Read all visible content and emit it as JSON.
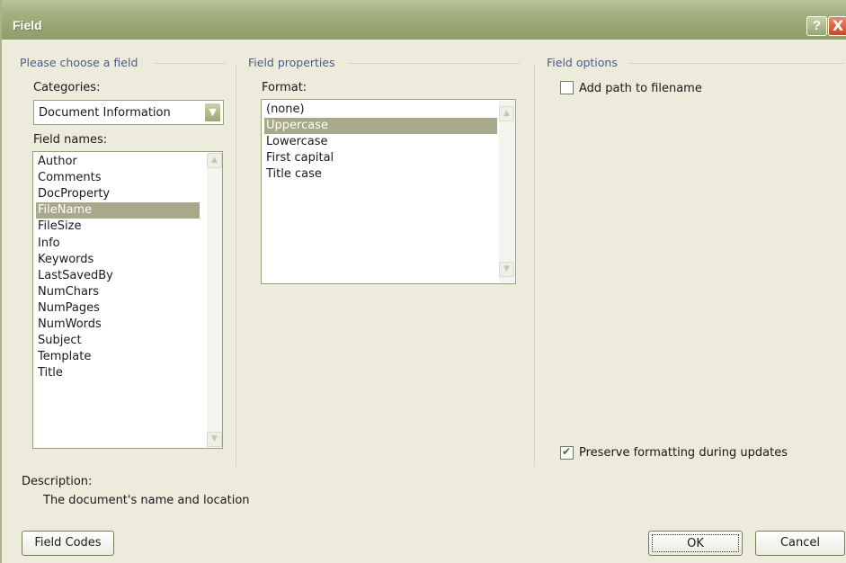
{
  "window": {
    "title": "Field"
  },
  "title_buttons": {
    "help": "?",
    "close": "X"
  },
  "left_group": {
    "title": "Please choose a field",
    "categories_label": "Categories:",
    "categories_value": "Document Information",
    "field_names_label": "Field names:",
    "field_names": [
      "Author",
      "Comments",
      "DocProperty",
      "FileName",
      "FileSize",
      "Info",
      "Keywords",
      "LastSavedBy",
      "NumChars",
      "NumPages",
      "NumWords",
      "Subject",
      "Template",
      "Title"
    ],
    "selected_field": "FileName"
  },
  "middle_group": {
    "title": "Field properties",
    "format_label": "Format:",
    "formats": [
      "(none)",
      "Uppercase",
      "Lowercase",
      "First capital",
      "Title case"
    ],
    "selected_format": "Uppercase"
  },
  "right_group": {
    "title": "Field options",
    "add_path_label": "Add path to filename",
    "add_path_checked": false,
    "preserve_label": "Preserve formatting during updates",
    "preserve_checked": true
  },
  "description": {
    "label": "Description:",
    "text": "The document's name and location"
  },
  "buttons": {
    "field_codes": "Field Codes",
    "ok": "OK",
    "cancel": "Cancel"
  },
  "colors": {
    "titlebar": "#a2b07f",
    "selection": "#a7a98a",
    "group_title": "#4b5c86"
  }
}
